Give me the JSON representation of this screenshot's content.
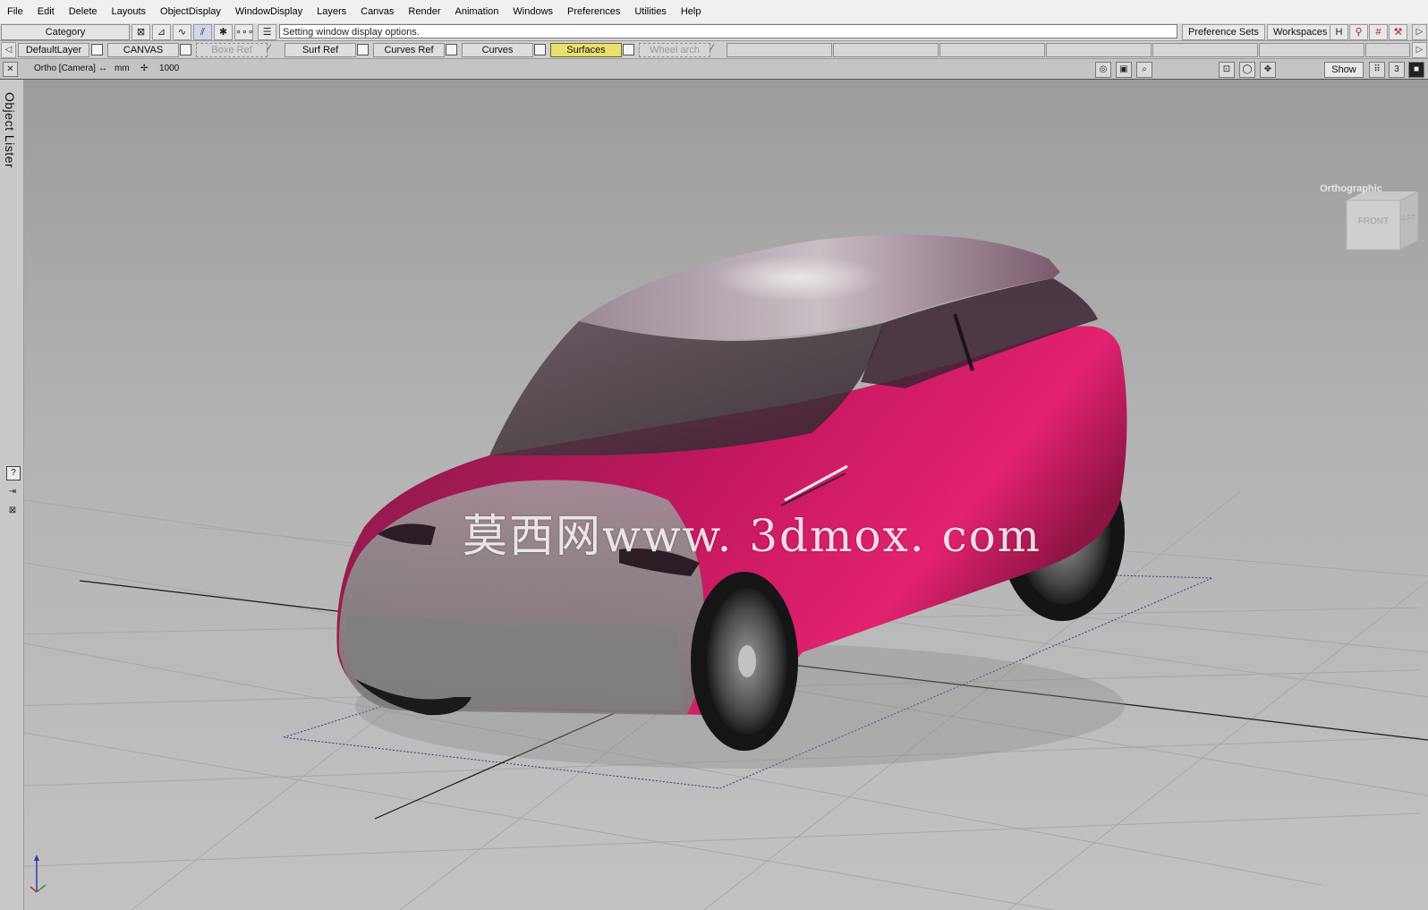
{
  "menubar": {
    "items": [
      "File",
      "Edit",
      "Delete",
      "Layouts",
      "ObjectDisplay",
      "WindowDisplay",
      "Layers",
      "Canvas",
      "Render",
      "Animation",
      "Windows",
      "Preferences",
      "Utilities",
      "Help"
    ]
  },
  "toolbar": {
    "category": "Category",
    "prompt": "Setting window display options.",
    "preference_sets": "Preference Sets",
    "workspaces": "Workspaces"
  },
  "layers": {
    "items": [
      {
        "label": "DefaultLayer",
        "state": "normal"
      },
      {
        "label": "CANVAS",
        "state": "normal"
      },
      {
        "label": "Boxe Ref",
        "state": "dim"
      },
      {
        "label": "Surf Ref",
        "state": "normal"
      },
      {
        "label": "Curves Ref",
        "state": "normal"
      },
      {
        "label": "Curves",
        "state": "normal"
      },
      {
        "label": "Surfaces",
        "state": "active"
      },
      {
        "label": "Wheel arch",
        "state": "dim"
      }
    ]
  },
  "viewbar": {
    "camera": "Ortho [Camera]",
    "units": "mm",
    "scale": "1000",
    "show_label": "Show",
    "layout_number": "3"
  },
  "sidebar": {
    "object_lister": "Object Lister"
  },
  "viewport": {
    "watermark": "莫西网www. 3dmox. com",
    "viewcube_front": "FRONT",
    "viewcube_right": "LFT",
    "projection": "Orthographic",
    "car_color": "#c4185e",
    "grid_color": "#9a9a9a",
    "bg_color": "#b8b8b8"
  },
  "colors": {
    "active_layer": "#e8e070",
    "menubar": "#f0f0f0",
    "toolbar": "#d9d9d9"
  }
}
